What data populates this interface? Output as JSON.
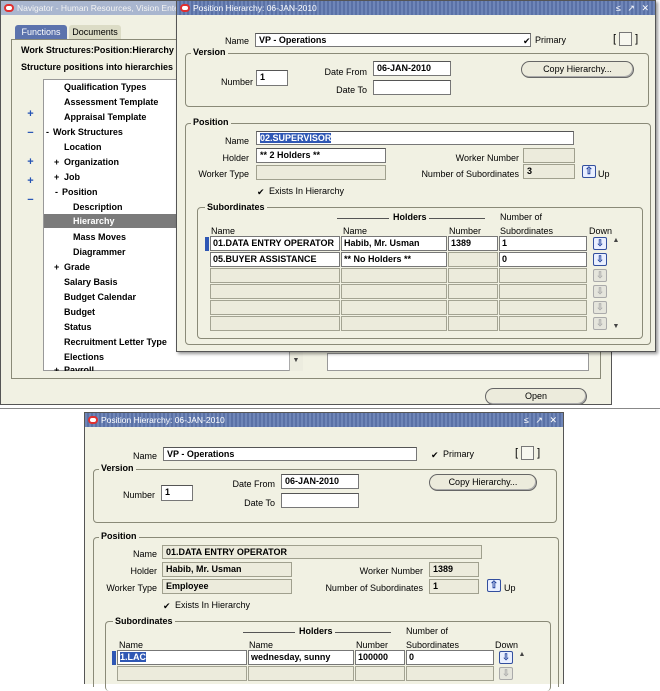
{
  "navigator": {
    "title": "Navigator - Human Resources, Vision Ente",
    "tabs": [
      "Functions",
      "Documents"
    ],
    "heading": "Work Structures:Position:Hierarchy",
    "subheading": "Structure positions into hierarchies",
    "tree": [
      {
        "label": "Qualification Types",
        "prefix": ""
      },
      {
        "label": "Assessment Template",
        "prefix": ""
      },
      {
        "label": "Appraisal Template",
        "prefix": ""
      },
      {
        "label": "Work Structures",
        "prefix": "-"
      },
      {
        "label": "Location",
        "prefix": ""
      },
      {
        "label": "Organization",
        "prefix": "+"
      },
      {
        "label": "Job",
        "prefix": "+"
      },
      {
        "label": "Position",
        "prefix": "-"
      },
      {
        "label": "Description",
        "prefix": ""
      },
      {
        "label": "Hierarchy",
        "prefix": ""
      },
      {
        "label": "Mass Moves",
        "prefix": ""
      },
      {
        "label": "Diagrammer",
        "prefix": ""
      },
      {
        "label": "Grade",
        "prefix": "+"
      },
      {
        "label": "Salary Basis",
        "prefix": ""
      },
      {
        "label": "Budget Calendar",
        "prefix": ""
      },
      {
        "label": "Budget",
        "prefix": ""
      },
      {
        "label": "Status",
        "prefix": ""
      },
      {
        "label": "Recruitment Letter Type",
        "prefix": ""
      },
      {
        "label": "Elections",
        "prefix": ""
      },
      {
        "label": "Payroll",
        "prefix": "+"
      }
    ],
    "side_buttons": [
      "+",
      "−",
      "+",
      "+",
      "−"
    ],
    "open_button": "Open"
  },
  "windows": [
    {
      "title": "Position Hierarchy: 06-JAN-2010",
      "controls": "≤ ↗ ✕",
      "labels": {
        "name": "Name",
        "primary": "Primary",
        "version": "Version",
        "number": "Number",
        "date_from": "Date From",
        "date_to": "Date To",
        "copy": "Copy Hierarchy...",
        "position": "Position",
        "holder": "Holder",
        "worker_type": "Worker Type",
        "worker_number": "Worker Number",
        "num_subordinates": "Number of Subordinates",
        "up": "Up",
        "exists": "Exists In Hierarchy",
        "subordinates": "Subordinates",
        "holders": "Holders",
        "col_name": "Name",
        "col_hname": "Name",
        "col_number": "Number",
        "col_nsub1": "Number of",
        "col_nsub2": "Subordinates",
        "col_down": "Down"
      },
      "name": "VP - Operations",
      "version_number": "1",
      "date_from": "06-JAN-2010",
      "date_to": "",
      "position_name": "02.SUPERVISOR",
      "holder": "** 2 Holders **",
      "worker_type": "",
      "worker_number": "",
      "num_subordinates": "3",
      "rows": [
        {
          "name": "01.DATA ENTRY OPERATOR",
          "holder": "Habib, Mr. Usman",
          "number": "1389",
          "subs": "1"
        },
        {
          "name": "05.BUYER ASSISTANCE",
          "holder": "** No Holders **",
          "number": "",
          "subs": "0"
        }
      ]
    },
    {
      "title": "Position Hierarchy: 06-JAN-2010",
      "controls": "≤ ↗ ✕",
      "labels": {
        "name": "Name",
        "primary": "Primary",
        "version": "Version",
        "number": "Number",
        "date_from": "Date From",
        "date_to": "Date To",
        "copy": "Copy Hierarchy...",
        "position": "Position",
        "holder": "Holder",
        "worker_type": "Worker Type",
        "worker_number": "Worker Number",
        "num_subordinates": "Number of Subordinates",
        "up": "Up",
        "exists": "Exists In Hierarchy",
        "subordinates": "Subordinates",
        "holders": "Holders",
        "col_name": "Name",
        "col_hname": "Name",
        "col_number": "Number",
        "col_nsub1": "Number of",
        "col_nsub2": "Subordinates",
        "col_down": "Down"
      },
      "name": "VP - Operations",
      "version_number": "1",
      "date_from": "06-JAN-2010",
      "date_to": "",
      "position_name": "01.DATA ENTRY OPERATOR",
      "holder": "Habib, Mr. Usman",
      "worker_type": "Employee",
      "worker_number": "1389",
      "num_subordinates": "1",
      "rows": [
        {
          "name": "1.LAC",
          "holder": "wednesday, sunny",
          "number": "100000",
          "subs": "0"
        }
      ]
    }
  ]
}
